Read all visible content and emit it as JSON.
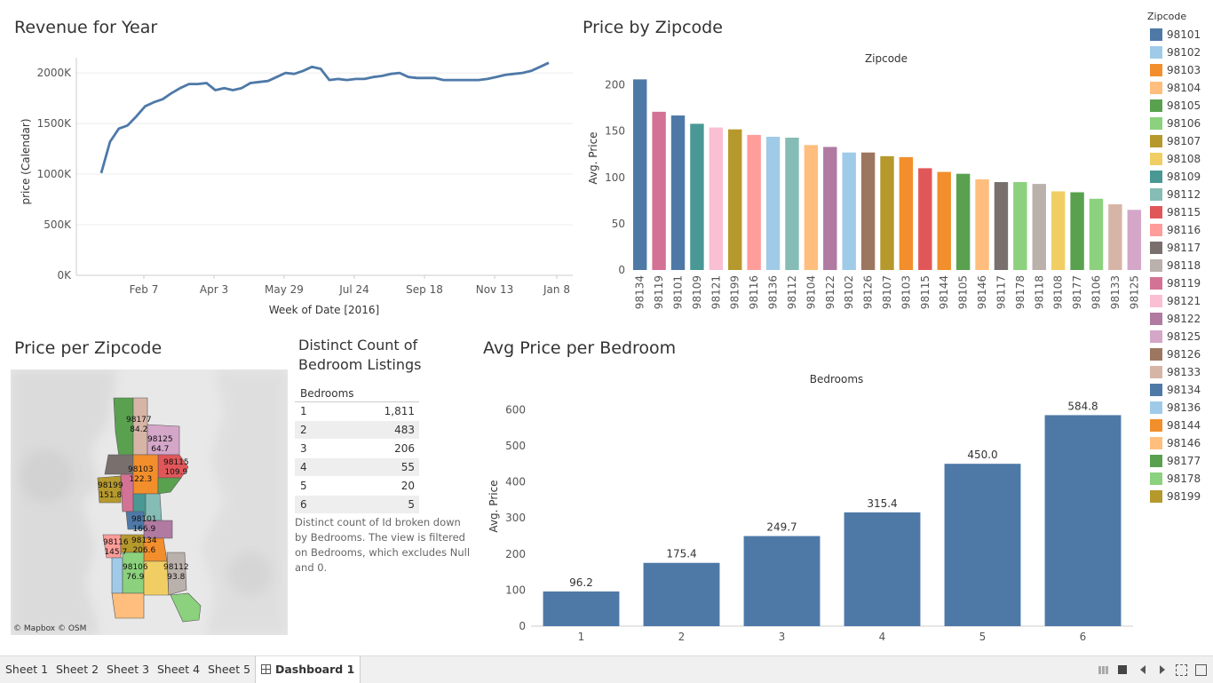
{
  "titles": {
    "revenue": "Revenue for Year",
    "zipcode_price": "Price by Zipcode",
    "zipcode_map": "Price per Zipcode",
    "distinct_l1": "Distinct Count of",
    "distinct_l2": "Bedroom Listings",
    "bedroom_price": "Avg Price per Bedroom"
  },
  "legend": {
    "title": "Zipcode",
    "items": [
      {
        "label": "98101",
        "color": "#4e79a7"
      },
      {
        "label": "98102",
        "color": "#a0cbe8"
      },
      {
        "label": "98103",
        "color": "#f28e2b"
      },
      {
        "label": "98104",
        "color": "#ffbe7d"
      },
      {
        "label": "98105",
        "color": "#59a14f"
      },
      {
        "label": "98106",
        "color": "#8cd17d"
      },
      {
        "label": "98107",
        "color": "#b6992d"
      },
      {
        "label": "98108",
        "color": "#f1ce63"
      },
      {
        "label": "98109",
        "color": "#499894"
      },
      {
        "label": "98112",
        "color": "#86bcb6"
      },
      {
        "label": "98115",
        "color": "#e15759"
      },
      {
        "label": "98116",
        "color": "#ff9d9a"
      },
      {
        "label": "98117",
        "color": "#79706e"
      },
      {
        "label": "98118",
        "color": "#bab0ac"
      },
      {
        "label": "98119",
        "color": "#d37295"
      },
      {
        "label": "98121",
        "color": "#fabfd2"
      },
      {
        "label": "98122",
        "color": "#b07aa1"
      },
      {
        "label": "98125",
        "color": "#d4a6c8"
      },
      {
        "label": "98126",
        "color": "#9d7660"
      },
      {
        "label": "98133",
        "color": "#d7b5a6"
      },
      {
        "label": "98134",
        "color": "#4e79a7"
      },
      {
        "label": "98136",
        "color": "#a0cbe8"
      },
      {
        "label": "98144",
        "color": "#f28e2b"
      },
      {
        "label": "98146",
        "color": "#ffbe7d"
      },
      {
        "label": "98177",
        "color": "#59a14f"
      },
      {
        "label": "98178",
        "color": "#8cd17d"
      },
      {
        "label": "98199",
        "color": "#b6992d"
      }
    ]
  },
  "table": {
    "header": "Bedrooms",
    "rows": [
      {
        "k": "1",
        "v": "1,811"
      },
      {
        "k": "2",
        "v": "483"
      },
      {
        "k": "3",
        "v": "206"
      },
      {
        "k": "4",
        "v": "55"
      },
      {
        "k": "5",
        "v": "20"
      },
      {
        "k": "6",
        "v": "5"
      }
    ],
    "caption": "Distinct count of Id broken down by Bedrooms. The view is filtered on Bedrooms, which excludes Null and 0."
  },
  "map": {
    "credit": "© Mapbox © OSM",
    "labels": [
      {
        "zip": "98177",
        "val": "84.2",
        "color": "#59a14f"
      },
      {
        "zip": "98125",
        "val": "64.7",
        "color": "#d4a6c8"
      },
      {
        "zip": "98115",
        "val": "109.9",
        "color": "#e15759"
      },
      {
        "zip": "98103",
        "val": "122.3",
        "color": "#f28e2b"
      },
      {
        "zip": "98199",
        "val": "151.8",
        "color": "#b6992d"
      },
      {
        "zip": "98101",
        "val": "166.9",
        "color": "#4e79a7"
      },
      {
        "zip": "98116",
        "val": "145.7",
        "color": "#ff9d9a"
      },
      {
        "zip": "98134",
        "val": "206.6",
        "color": "#4e79a7"
      },
      {
        "zip": "98106",
        "val": "76.9",
        "color": "#8cd17d"
      },
      {
        "zip": "98112",
        "val": "93.8",
        "color": "#86bcb6"
      }
    ]
  },
  "tabs": {
    "sheet1": "Sheet 1",
    "sheet2": "Sheet 2",
    "sheet3": "Sheet 3",
    "sheet4": "Sheet 4",
    "sheet5": "Sheet 5",
    "dashboard": "Dashboard 1"
  },
  "chart_data": [
    {
      "type": "line",
      "title": "Revenue for Year",
      "xlabel": "Week of Date [2016]",
      "ylabel": "price (Calendar)",
      "x_ticks": [
        "Feb 7",
        "Apr 3",
        "May 29",
        "Jul 24",
        "Sep 18",
        "Nov 13",
        "Jan 8"
      ],
      "y_ticks": [
        "0K",
        "500K",
        "1000K",
        "1500K",
        "2000K"
      ],
      "ylim": [
        0,
        2150000
      ],
      "series": [
        {
          "values": [
            1010000,
            1320000,
            1450000,
            1480000,
            1570000,
            1670000,
            1710000,
            1740000,
            1800000,
            1850000,
            1890000,
            1890000,
            1900000,
            1830000,
            1850000,
            1830000,
            1850000,
            1900000,
            1910000,
            1920000,
            1960000,
            2000000,
            1990000,
            2020000,
            2060000,
            2040000,
            1930000,
            1940000,
            1930000,
            1940000,
            1940000,
            1960000,
            1970000,
            1990000,
            2000000,
            1960000,
            1950000,
            1950000,
            1950000,
            1930000,
            1930000,
            1930000,
            1930000,
            1930000,
            1940000,
            1960000,
            1980000,
            1990000,
            2000000,
            2020000,
            2060000,
            2100000
          ]
        }
      ],
      "grid": true
    },
    {
      "type": "bar",
      "title": "Zipcode",
      "ylabel": "Avg. Price",
      "y_ticks": [
        "0",
        "50",
        "100",
        "150",
        "200"
      ],
      "ylim": [
        0,
        215
      ],
      "categories": [
        "98134",
        "98119",
        "98101",
        "98109",
        "98121",
        "98199",
        "98116",
        "98136",
        "98112",
        "98104",
        "98122",
        "98102",
        "98126",
        "98107",
        "98103",
        "98115",
        "98144",
        "98105",
        "98146",
        "98117",
        "98178",
        "98118",
        "98108",
        "98177",
        "98106",
        "98133",
        "98125"
      ],
      "values": [
        206,
        171,
        167,
        158,
        154,
        152,
        146,
        144,
        143,
        135,
        133,
        127,
        127,
        123,
        122,
        110,
        106,
        104,
        98,
        95,
        95,
        93,
        85,
        84,
        77,
        71,
        65
      ]
    },
    {
      "type": "bar",
      "title": "Bedrooms",
      "ylabel": "Avg. Price",
      "y_ticks": [
        "0",
        "100",
        "200",
        "300",
        "400",
        "500",
        "600"
      ],
      "ylim": [
        0,
        640
      ],
      "categories": [
        "1",
        "2",
        "3",
        "4",
        "5",
        "6"
      ],
      "values": [
        96.2,
        175.4,
        249.7,
        315.4,
        450.0,
        584.8
      ],
      "labels": [
        "96.2",
        "175.4",
        "249.7",
        "315.4",
        "450.0",
        "584.8"
      ],
      "color": "#4e79a7"
    }
  ]
}
